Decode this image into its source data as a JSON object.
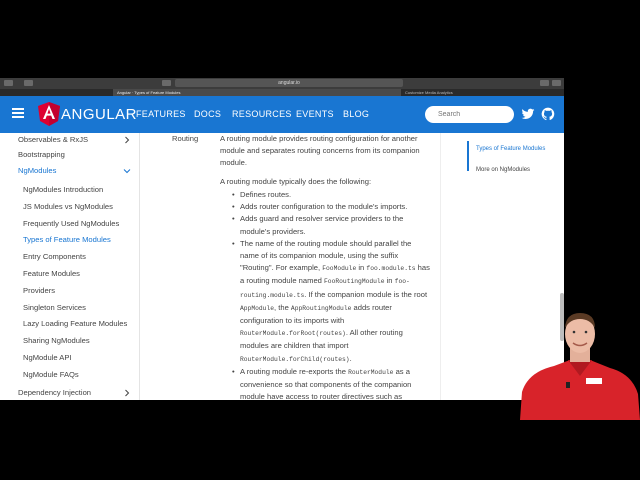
{
  "browser": {
    "address": "angular.io",
    "active_tab": "Angular · Types of Feature Modules",
    "other_tab": "Customize Media Analytics"
  },
  "nav": {
    "logo_text": "ANGULAR",
    "items": [
      "FEATURES",
      "DOCS",
      "RESOURCES",
      "EVENTS",
      "BLOG"
    ],
    "search_placeholder": "Search",
    "icons": [
      "menu-icon",
      "angular-logo-icon",
      "twitter-icon",
      "github-icon"
    ]
  },
  "sidebar": {
    "items": [
      {
        "label": "Observables & RxJS",
        "level": 1,
        "chevron": "right"
      },
      {
        "label": "Bootstrapping",
        "level": 1
      },
      {
        "label": "NgModules",
        "level": 1,
        "chevron": "down",
        "active": true
      },
      {
        "label": "NgModules Introduction",
        "level": 2
      },
      {
        "label": "JS Modules vs NgModules",
        "level": 2
      },
      {
        "label": "Frequently Used NgModules",
        "level": 2
      },
      {
        "label": "Types of Feature Modules",
        "level": 2,
        "active": true
      },
      {
        "label": "Entry Components",
        "level": 2
      },
      {
        "label": "Feature Modules",
        "level": 2
      },
      {
        "label": "Providers",
        "level": 2
      },
      {
        "label": "Singleton Services",
        "level": 2
      },
      {
        "label": "Lazy Loading Feature Modules",
        "level": 2
      },
      {
        "label": "Sharing NgModules",
        "level": 2
      },
      {
        "label": "NgModule API",
        "level": 2
      },
      {
        "label": "NgModule FAQs",
        "level": 2
      },
      {
        "label": "Dependency Injection",
        "level": 1,
        "chevron": "right"
      }
    ]
  },
  "content": {
    "row_label": "Routing",
    "intro": "A routing module provides routing configuration for another module and separates routing concerns from its companion module.",
    "lead": "A routing module typically does the following:",
    "bullets": {
      "b1": "Defines routes.",
      "b2": "Adds router configuration to the module's imports.",
      "b3": "Adds guard and resolver service providers to the module's providers.",
      "b4_a": "The name of the routing module should parallel the name of its companion module, using the suffix \"Routing\". For example,",
      "b4_code1": "FooModule",
      "b4_b": "in",
      "b4_code2": "foo.module.ts",
      "b4_c": "has a routing module named",
      "b4_code3": "FooRoutingModule",
      "b4_d": "in",
      "b4_code4": "foo-routing.module.ts",
      "b4_e": ". If the companion module is the root",
      "b4_code5": "AppModule",
      "b4_f": ", the",
      "b4_code6": "AppRoutingModule",
      "b4_g": "adds router configuration to its imports with",
      "b4_code7": "RouterModule.forRoot(routes)",
      "b4_h": ". All other routing modules are children that import",
      "b4_code8": "RouterModule.forChild(routes)",
      "b4_i": ".",
      "b5_a": "A routing module re-exports the",
      "b5_code1": "RouterModule",
      "b5_b": "as a convenience so that components of the companion module have access to router directives such as"
    }
  },
  "toc": {
    "items": [
      "Types of Feature Modules",
      "More on NgModules"
    ]
  },
  "colors": {
    "brand_blue": "#1976d2",
    "angular_red": "#dd0031"
  }
}
